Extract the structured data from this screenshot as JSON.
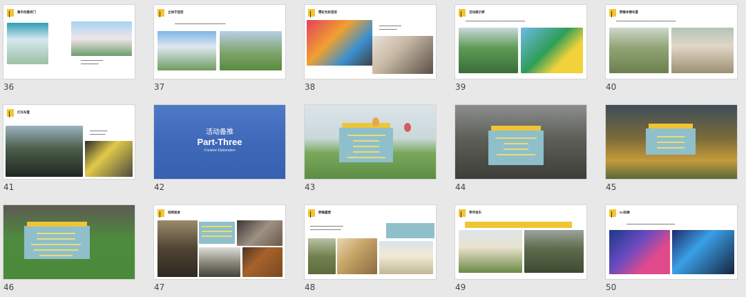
{
  "colors": {
    "background": "#e8e8e8",
    "slide": "#ffffff",
    "accent_yellow": "#f5c431",
    "panel_teal": "#8fbfca",
    "cover_blue": "#3f68b8"
  },
  "slides": [
    {
      "number": "36",
      "title": "集市创意拱门"
    },
    {
      "number": "37",
      "title": "立体字造型"
    },
    {
      "number": "38",
      "title": "霓虹色彩造型"
    },
    {
      "number": "39",
      "title": "活动展示牌"
    },
    {
      "number": "40",
      "title": "野餐休憩布置"
    },
    {
      "number": "41",
      "title": "灯光布置"
    },
    {
      "number": "42",
      "title": ""
    },
    {
      "number": "43",
      "title": ""
    },
    {
      "number": "44",
      "title": ""
    },
    {
      "number": "45",
      "title": ""
    },
    {
      "number": "46",
      "title": ""
    },
    {
      "number": "47",
      "title": "烧烤美食"
    },
    {
      "number": "48",
      "title": "野餐露营"
    },
    {
      "number": "49",
      "title": "草坪音乐"
    },
    {
      "number": "50",
      "title": "DJ热舞"
    }
  ],
  "cover": {
    "cn_title": "活动备推",
    "en_title": "Part-Three",
    "subtitle": "Creative Elaboration"
  }
}
